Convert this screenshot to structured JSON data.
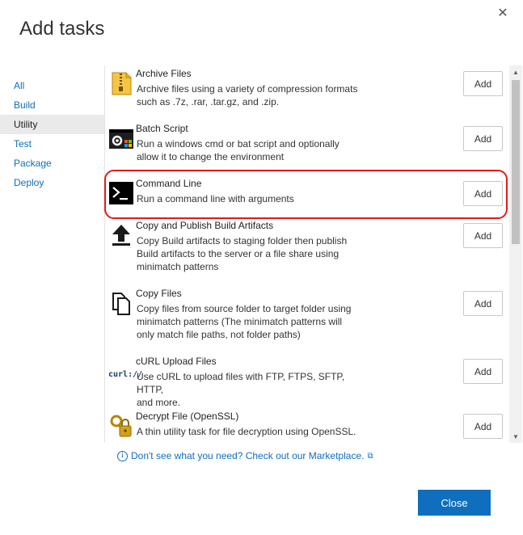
{
  "dialog": {
    "title": "Add tasks",
    "close_glyph": "✕"
  },
  "nav": {
    "items": [
      {
        "label": "All"
      },
      {
        "label": "Build"
      },
      {
        "label": "Utility",
        "selected": true
      },
      {
        "label": "Test"
      },
      {
        "label": "Package"
      },
      {
        "label": "Deploy"
      }
    ]
  },
  "tasks": [
    {
      "name": "Archive Files",
      "desc_lines": [
        "Archive files using a variety of compression formats",
        "such as .7z, .rar, .tar.gz, and .zip."
      ],
      "icon": "zip-archive-icon",
      "add_label": "Add"
    },
    {
      "name": "Batch Script",
      "desc_lines": [
        "Run a windows cmd or bat script and optionally",
        "allow it to change the environment"
      ],
      "icon": "batch-script-icon",
      "add_label": "Add"
    },
    {
      "name": "Command Line",
      "desc_lines": [
        "Run a command line with arguments"
      ],
      "icon": "terminal-icon",
      "add_label": "Add",
      "highlighted": true
    },
    {
      "name": "Copy and Publish Build Artifacts",
      "desc_lines": [
        "Copy Build artifacts to staging folder then publish",
        "Build artifacts to the server or a file share using",
        "minimatch patterns"
      ],
      "icon": "upload-arrow-icon",
      "add_label": "Add"
    },
    {
      "name": "Copy Files",
      "desc_lines": [
        "Copy files from source folder to target folder using",
        "minimatch patterns (The minimatch patterns will",
        "only match file paths, not folder paths)"
      ],
      "icon": "copy-files-icon",
      "add_label": "Add"
    },
    {
      "name": "cURL Upload Files",
      "desc_lines": [
        "Use cURL to upload files with FTP, FTPS, SFTP, HTTP,",
        "and more."
      ],
      "icon": "curl-icon",
      "icon_text": "curl://",
      "add_label": "Add"
    },
    {
      "name": "Decrypt File (OpenSSL)",
      "desc_lines": [
        "A thin utility task for file decryption using OpenSSL."
      ],
      "icon": "key-lock-icon",
      "add_label": "Add"
    }
  ],
  "footer": {
    "info_glyph": "i",
    "marketplace_link": "Don't see what you need? Check out our Marketplace.",
    "external_glyph": "⧉",
    "close_label": "Close"
  },
  "scrollbar": {
    "up_glyph": "▲",
    "down_glyph": "▼"
  },
  "colors": {
    "accent": "#106ebe",
    "highlight": "#e01b1b",
    "selected_bg": "#eaeaea"
  }
}
